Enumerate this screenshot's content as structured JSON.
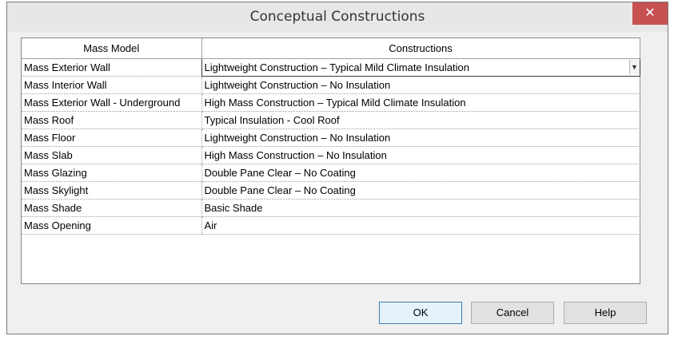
{
  "window": {
    "title": "Conceptual Constructions",
    "close_glyph": "✕"
  },
  "table": {
    "columns": [
      "Mass Model",
      "Constructions"
    ],
    "rows": [
      [
        "Mass Exterior Wall",
        "Lightweight Construction – Typical Mild Climate Insulation"
      ],
      [
        "Mass Interior Wall",
        "Lightweight Construction – No Insulation"
      ],
      [
        "Mass Exterior Wall - Underground",
        "High Mass Construction – Typical Mild Climate Insulation"
      ],
      [
        "Mass Roof",
        "Typical Insulation - Cool Roof"
      ],
      [
        "Mass Floor",
        "Lightweight Construction – No Insulation"
      ],
      [
        "Mass Slab",
        "High Mass Construction – No Insulation"
      ],
      [
        "Mass Glazing",
        "Double Pane Clear – No Coating"
      ],
      [
        "Mass Skylight",
        "Double Pane Clear – No Coating"
      ],
      [
        "Mass Shade",
        "Basic Shade"
      ],
      [
        "Mass Opening",
        "Air"
      ]
    ],
    "selected_row_index": 0
  },
  "buttons": {
    "ok": "OK",
    "cancel": "Cancel",
    "help": "Help"
  },
  "colors": {
    "close_button": "#c75050",
    "default_button_border": "#3c7fb1"
  }
}
